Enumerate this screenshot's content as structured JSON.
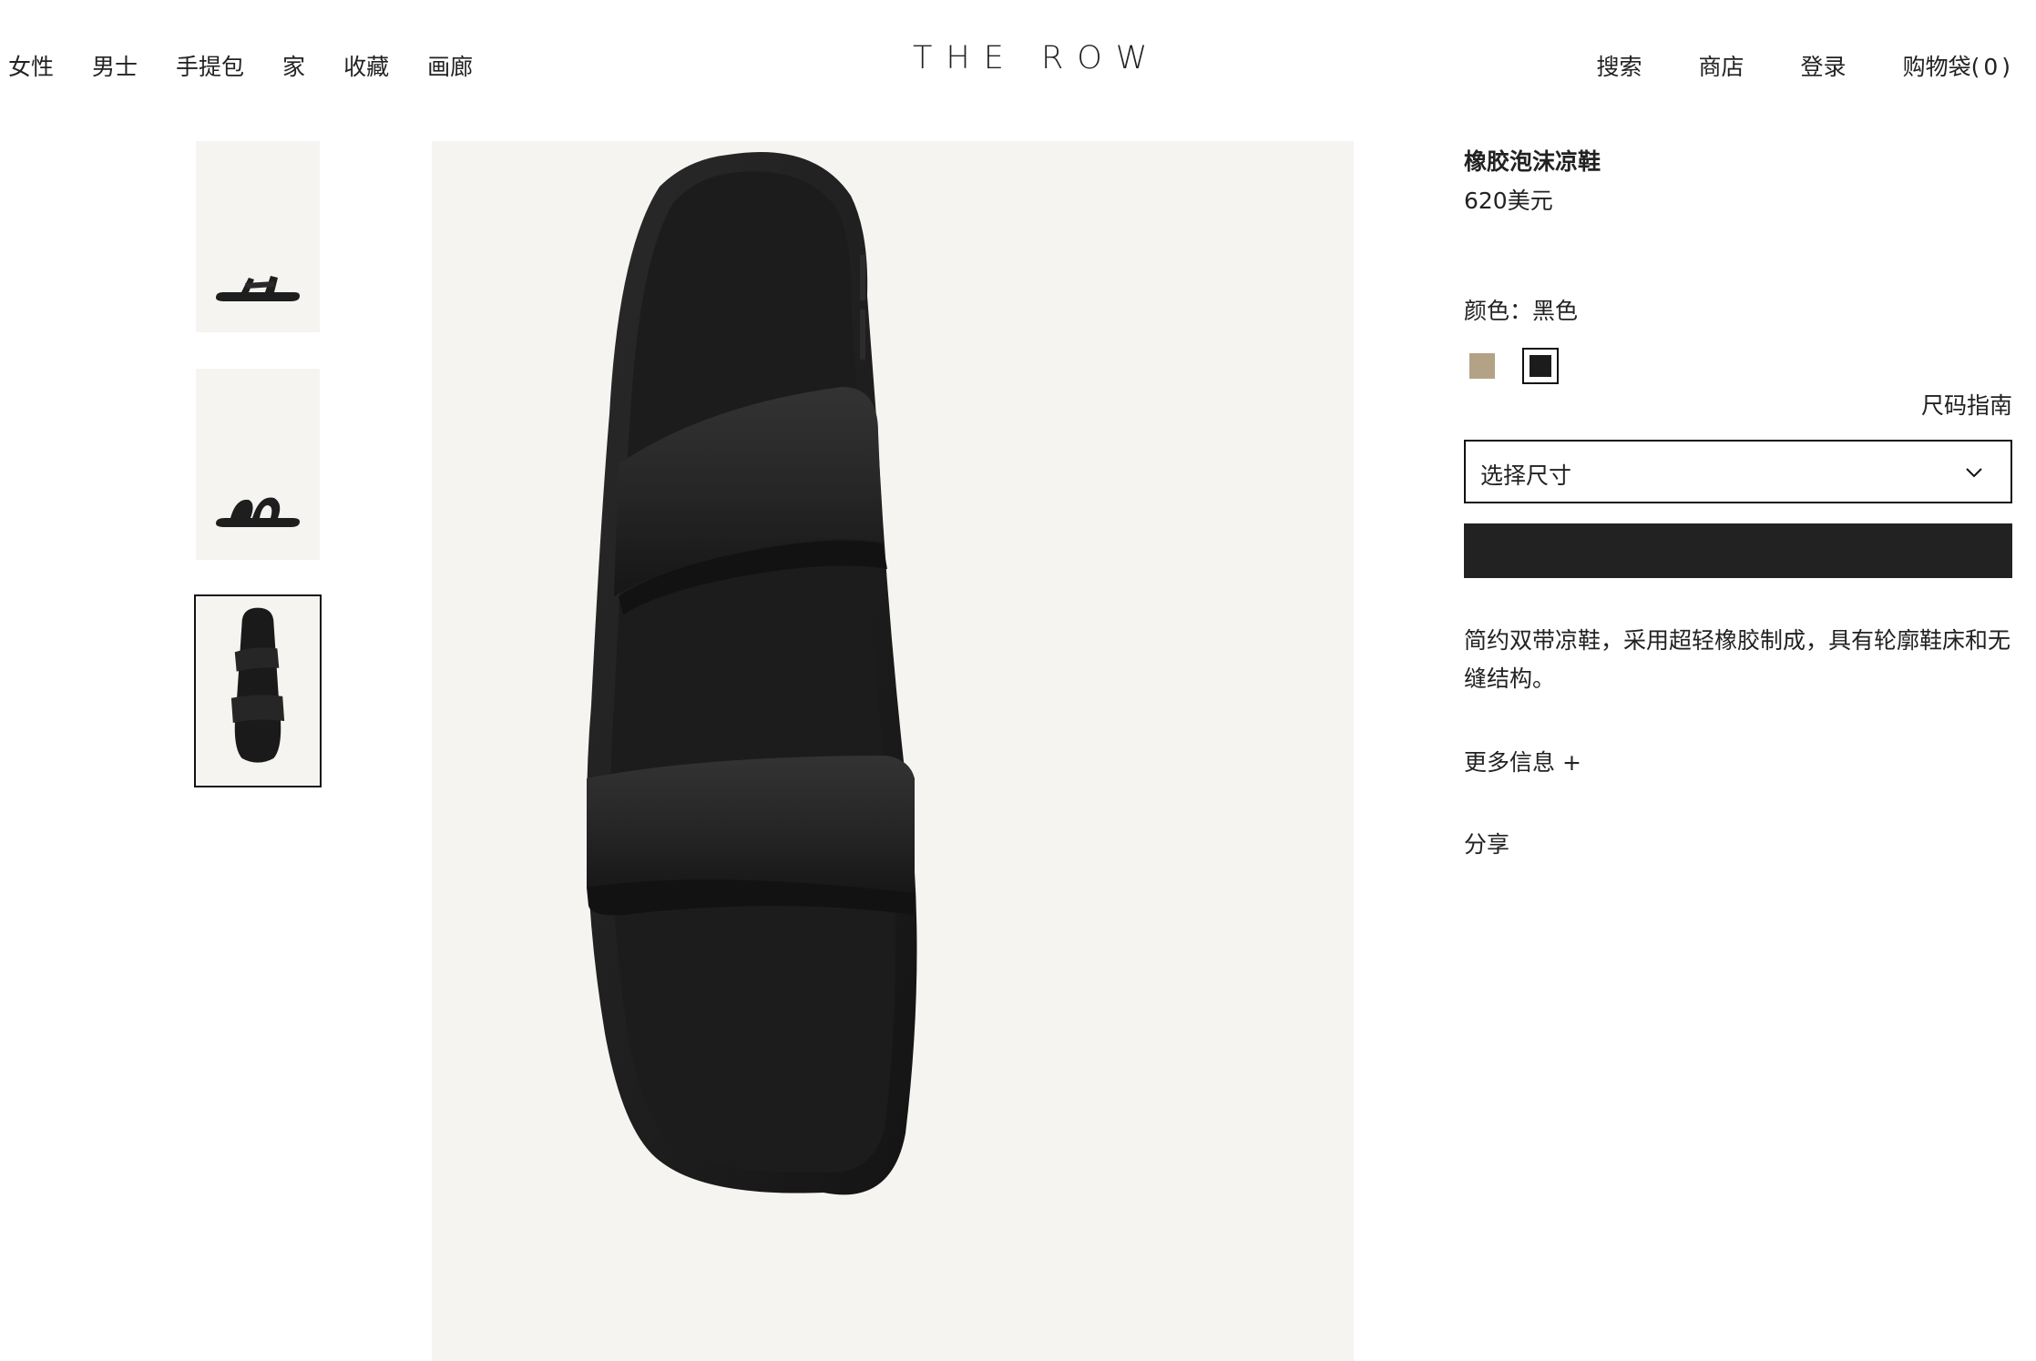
{
  "header": {
    "nav_left": [
      "女性",
      "男士",
      "手提包",
      "家",
      "收藏",
      "画廊"
    ],
    "logo": "THE ROW",
    "nav_right": {
      "search": "搜索",
      "shop": "商店",
      "login": "登录",
      "bag": "购物袋",
      "bag_count": "(0)"
    }
  },
  "product": {
    "name": "橡胶泡沫凉鞋",
    "price": "620美元",
    "color_label": "颜色：黑色",
    "swatches": [
      {
        "name": "tan",
        "color": "#b3a286"
      },
      {
        "name": "black",
        "color": "#1c1c1c",
        "selected": true
      }
    ],
    "size_guide": "尺码指南",
    "size_select_placeholder": "选择尺寸",
    "description": "简约双带凉鞋，采用超轻橡胶制成，具有轮廓鞋床和无缝结构。",
    "more_info": "更多信息",
    "more_info_icon": "+",
    "share": "分享"
  },
  "colors": {
    "image_background": "#f5f4f1",
    "button_background": "#222222"
  }
}
